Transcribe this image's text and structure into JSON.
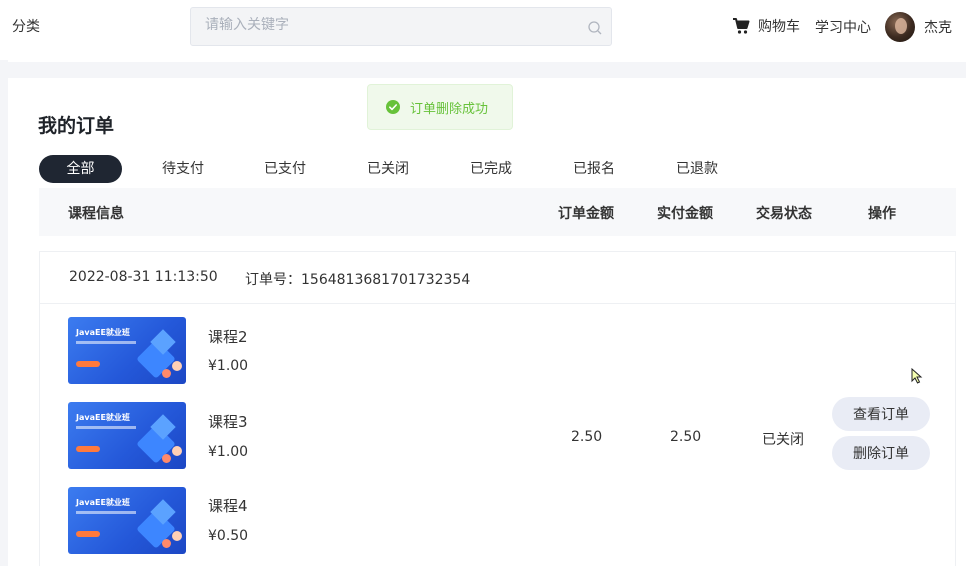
{
  "header": {
    "category": "分类",
    "search_placeholder": "请输入关键字",
    "cart": "购物车",
    "study_center": "学习中心",
    "username": "杰克"
  },
  "toast": {
    "message": "订单删除成功",
    "color": "#67c23a"
  },
  "page_title": "我的订单",
  "tabs": [
    {
      "label": "全部",
      "active": true
    },
    {
      "label": "待支付",
      "active": false
    },
    {
      "label": "已支付",
      "active": false
    },
    {
      "label": "已关闭",
      "active": false
    },
    {
      "label": "已完成",
      "active": false
    },
    {
      "label": "已报名",
      "active": false
    },
    {
      "label": "已退款",
      "active": false
    }
  ],
  "table_header": {
    "course_info": "课程信息",
    "order_amount": "订单金额",
    "paid_amount": "实付金额",
    "status": "交易状态",
    "actions": "操作"
  },
  "order": {
    "datetime": "2022-08-31 11:13:50",
    "order_no_label": "订单号：",
    "order_no": "1564813681701732354",
    "courses": [
      {
        "name": "课程2",
        "price": "¥1.00",
        "thumb_text": "JavaEE就业班"
      },
      {
        "name": "课程3",
        "price": "¥1.00",
        "thumb_text": "JavaEE就业班"
      },
      {
        "name": "课程4",
        "price": "¥0.50",
        "thumb_text": "JavaEE就业班"
      }
    ],
    "order_amount": "2.50",
    "paid_amount": "2.50",
    "status": "已关闭",
    "view_button": "查看订单",
    "delete_button": "删除订单"
  },
  "colors": {
    "tab_active_bg": "#1f2632",
    "button_bg": "#e9ecf5",
    "toast_bg": "#f0f9eb"
  }
}
